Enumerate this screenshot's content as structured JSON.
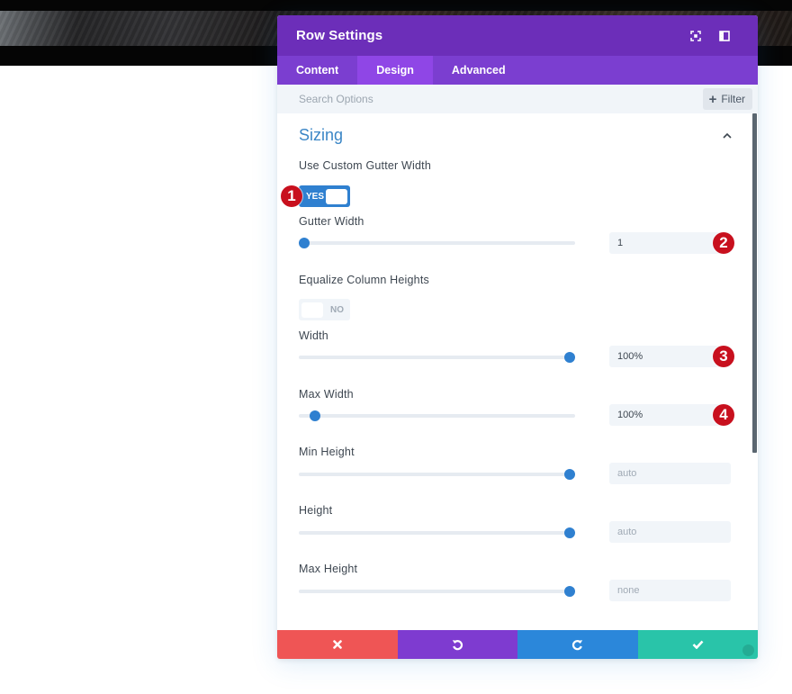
{
  "modal": {
    "title": "Row Settings",
    "header_icons": [
      "expand-modal-icon",
      "sidebar-layout-icon"
    ],
    "tabs": [
      {
        "label": "Content",
        "active": false
      },
      {
        "label": "Design",
        "active": true
      },
      {
        "label": "Advanced",
        "active": false
      }
    ],
    "search": {
      "placeholder": "Search Options",
      "value": ""
    },
    "filter_label": "Filter",
    "section": {
      "title": "Sizing",
      "expanded": true
    },
    "fields": {
      "custom_gutter": {
        "label": "Use Custom Gutter Width",
        "toggle_text": "YES",
        "on": true,
        "badge": "1"
      },
      "gutter_width": {
        "label": "Gutter Width",
        "value": "1",
        "slider_position": 0.02,
        "badge": "2"
      },
      "equalize": {
        "label": "Equalize Column Heights",
        "toggle_text": "NO",
        "on": false
      },
      "width": {
        "label": "Width",
        "value": "100%",
        "slider_position": 0.98,
        "badge": "3"
      },
      "max_width": {
        "label": "Max Width",
        "value": "100%",
        "slider_position": 0.06,
        "badge": "4"
      },
      "min_height": {
        "label": "Min Height",
        "value": "auto",
        "slider_position": 0.98
      },
      "height": {
        "label": "Height",
        "value": "auto",
        "slider_position": 0.98
      },
      "max_height": {
        "label": "Max Height",
        "value": "none",
        "slider_position": 0.98
      }
    },
    "footer": {
      "buttons": [
        "cancel",
        "undo",
        "redo",
        "save"
      ],
      "colors": {
        "cancel": "#ef5555",
        "undo": "#7e3bd0",
        "redo": "#2b87da",
        "save": "#29c4a9"
      }
    }
  },
  "colors": {
    "header": "#6c2eb9",
    "tabs": "#7b3ed0",
    "active_tab": "#8f46e6",
    "accent": "#2f80d0",
    "section_title": "#3b86c6",
    "badge": "#c8101e"
  }
}
